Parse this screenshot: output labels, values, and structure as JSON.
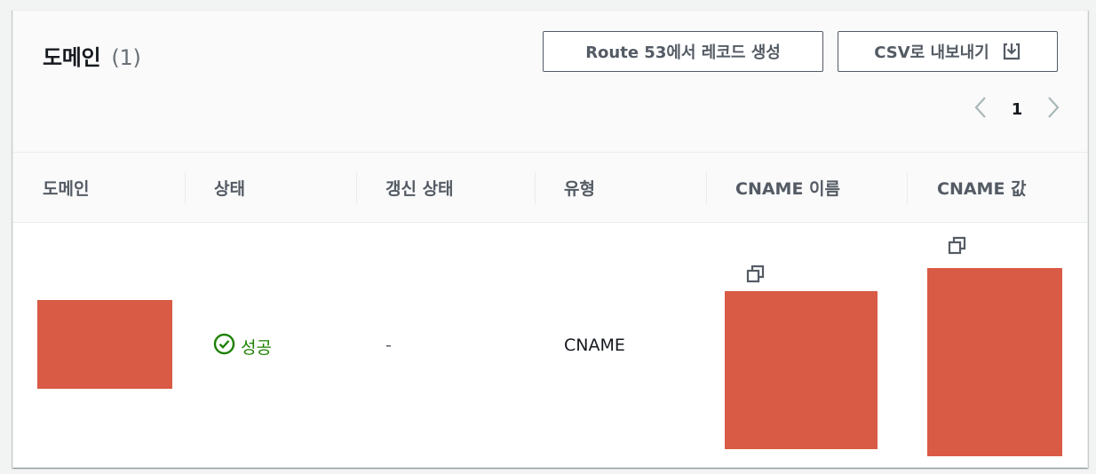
{
  "header": {
    "title": "도메인",
    "count": "(1)",
    "route53_button": "Route 53에서 레코드 생성",
    "csv_button": "CSV로 내보내기",
    "download_icon": "download-icon"
  },
  "pagination": {
    "current_page": "1",
    "prev_icon": "chevron-left-icon",
    "next_icon": "chevron-right-icon"
  },
  "table": {
    "columns": [
      "도메인",
      "상태",
      "갱신 상태",
      "유형",
      "CNAME 이름",
      "CNAME 값"
    ],
    "rows": [
      {
        "domain": "",
        "status": "성공",
        "status_icon": "check-circle-icon",
        "status_color": "#1d8102",
        "renewal_status": "-",
        "type": "CNAME",
        "cname_name": "",
        "cname_value": ""
      }
    ]
  },
  "colors": {
    "redaction": "#d95a45",
    "button_border": "#545b64",
    "success": "#1d8102"
  }
}
